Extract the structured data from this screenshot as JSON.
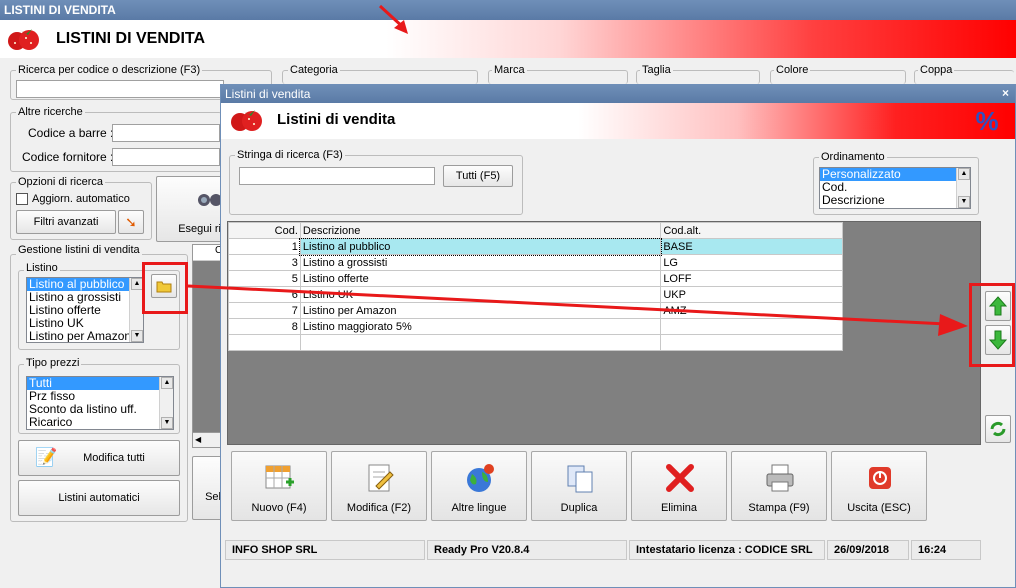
{
  "window": {
    "title": "LISTINI DI VENDITA",
    "header_title": "LISTINI DI VENDITA"
  },
  "filters": {
    "search_label": "Ricerca per codice o descrizione (F3)",
    "categoria": "Categoria",
    "marca": "Marca",
    "taglia": "Taglia",
    "colore": "Colore",
    "coppa": "Coppa"
  },
  "altre_ricerche": {
    "label": "Altre ricerche",
    "barcode_label": "Codice a barre :",
    "supplier_label": "Codice fornitore :"
  },
  "opzioni": {
    "label": "Opzioni di ricerca",
    "auto_update": "Aggiorn. automatico",
    "advanced_filters": "Filtri avanzati",
    "run_search": "Esegui ri"
  },
  "gestione": {
    "label": "Gestione listini di vendita",
    "listino_label": "Listino",
    "listino_items": [
      "Listino al pubblico",
      "Listino a grossisti",
      "Listino offerte",
      "Listino UK",
      "Listino per Amazon"
    ],
    "tipo_prezzi_label": "Tipo prezzi",
    "tipo_prezzi_items": [
      "Tutti",
      "Prz fisso",
      "Sconto da listino uff.",
      "Ricarico"
    ],
    "modifica_tutti": "Modifica tutti",
    "listini_automatici": "Listini automatici",
    "partial_sel": "Sel",
    "partial_c": "C",
    "partial_paren": "("
  },
  "dialog": {
    "title": "Listini di vendita",
    "close": "×",
    "header_title": "Listini di vendita",
    "percent_icon": "%",
    "search_label": "Stringa di ricerca (F3)",
    "search_value": "",
    "tutti_button": "Tutti (F5)",
    "ordinamento_label": "Ordinamento",
    "ordinamento_items": [
      "Personalizzato",
      "Cod.",
      "Descrizione"
    ],
    "columns": [
      "Cod.",
      "Descrizione",
      "Cod.alt."
    ],
    "rows": [
      {
        "cod": "1",
        "descrizione": "Listino al pubblico",
        "cod_alt": "BASE"
      },
      {
        "cod": "3",
        "descrizione": "Listino a grossisti",
        "cod_alt": "LG"
      },
      {
        "cod": "5",
        "descrizione": "Listino offerte",
        "cod_alt": "LOFF"
      },
      {
        "cod": "6",
        "descrizione": "Listino UK",
        "cod_alt": "UKP"
      },
      {
        "cod": "7",
        "descrizione": "Listino per Amazon",
        "cod_alt": "AMZ"
      },
      {
        "cod": "8",
        "descrizione": "Listino maggiorato 5%",
        "cod_alt": ""
      }
    ],
    "toolbar": {
      "nuovo": "Nuovo (F4)",
      "modifica": "Modifica (F2)",
      "altre_lingue": "Altre lingue",
      "duplica": "Duplica",
      "elimina": "Elimina",
      "stampa": "Stampa (F9)",
      "uscita": "Uscita (ESC)"
    },
    "status": {
      "company": "INFO SHOP SRL",
      "version": "Ready Pro V20.8.4",
      "license": "Intestatario licenza : CODICE SRL",
      "date": "26/09/2018",
      "time": "16:24"
    }
  },
  "colors": {
    "accent_red": "#e8191a",
    "selection_blue": "#3399ff",
    "selected_row": "#a8e8f0",
    "grid_bg": "#808080"
  }
}
